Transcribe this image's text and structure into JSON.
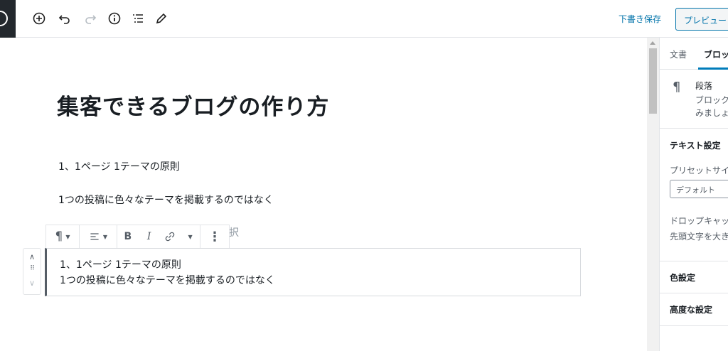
{
  "header": {
    "save_draft": "下書き保存",
    "preview": "プレビュー"
  },
  "toolbar_icons": [
    "add-block-icon",
    "undo-icon",
    "redo-icon",
    "info-icon",
    "outline-icon",
    "edit-icon"
  ],
  "editor": {
    "title": "集客できるブログの作り方",
    "paragraphs": [
      "1、1ページ 1テーマの原則",
      "1つの投稿に色々なテーマを掲載するのではなく"
    ],
    "partially_hidden_text": "択",
    "selected_block": {
      "lines": [
        "1、1ページ 1テーマの原則",
        "1つの投稿に色々なテーマを掲載するのではなく"
      ]
    },
    "block_toolbar": {
      "block_type_icon": "paragraph-icon",
      "align_icon": "align-left-icon",
      "bold": "B",
      "italic": "I",
      "link_icon": "link-icon",
      "more_icon": "more-vertical-icon"
    }
  },
  "sidebar": {
    "tabs": [
      "文書",
      "ブロック"
    ],
    "active_tab": "ブロック",
    "block_card": {
      "title": "段落",
      "desc_line1": "ブロック",
      "desc_line2": "みましょ"
    },
    "text_settings": {
      "title": "テキスト設定",
      "preset_label": "プリセットサイ",
      "preset_value": "デフォルト",
      "drop_cap_label": "ドロップキャッ",
      "drop_cap_help": "先頭文字を大き"
    },
    "color_settings": "色設定",
    "advanced": "高度な設定"
  },
  "colors": {
    "accent": "#0073aa",
    "tab_underline": "#007cba",
    "wp_dark": "#23282d"
  }
}
